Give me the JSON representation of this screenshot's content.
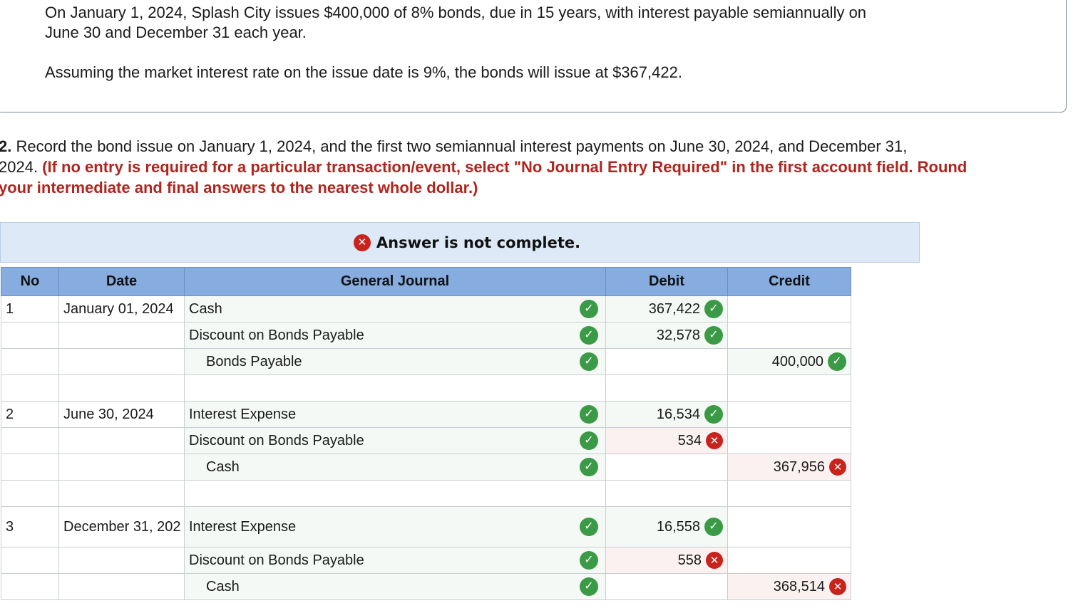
{
  "problem": {
    "line1": "On January 1, 2024, Splash City issues $400,000 of 8% bonds, due in 15 years, with interest payable semiannually on",
    "line2": "June 30 and December 31 each year.",
    "line3": "Assuming the market interest rate on the issue date is 9%, the bonds will issue at $367,422."
  },
  "question": {
    "number": "2.",
    "line1_text": " Record the bond issue on January 1, 2024, and the first two semiannual interest payments on June 30, 2024, and December 31,",
    "line2_text": "2024. ",
    "line2_instr": "(If no entry is required for a particular transaction/event, select \"No Journal Entry Required\" in the first account field. Round",
    "line3_instr": "your intermediate and final answers to the nearest whole dollar.)"
  },
  "banner": {
    "text": "Answer is not complete."
  },
  "table": {
    "headers": {
      "no": "No",
      "date": "Date",
      "journal": "General Journal",
      "debit": "Debit",
      "credit": "Credit"
    },
    "rows": [
      {
        "no": "1",
        "date": "January 01, 2024",
        "account": "Cash",
        "indent": false,
        "account_status": "correct",
        "debit": "367,422",
        "debit_status": "correct",
        "credit": "",
        "credit_status": ""
      },
      {
        "no": "",
        "date": "",
        "account": "Discount on Bonds Payable",
        "indent": false,
        "account_status": "correct",
        "debit": "32,578",
        "debit_status": "correct",
        "credit": "",
        "credit_status": ""
      },
      {
        "no": "",
        "date": "",
        "account": "Bonds Payable",
        "indent": true,
        "account_status": "correct",
        "debit": "",
        "debit_status": "",
        "credit": "400,000",
        "credit_status": "correct"
      },
      {
        "no": "",
        "date": "",
        "account": "",
        "indent": false,
        "account_status": "",
        "debit": "",
        "debit_status": "",
        "credit": "",
        "credit_status": ""
      },
      {
        "no": "2",
        "date": "June 30, 2024",
        "account": "Interest Expense",
        "indent": false,
        "account_status": "correct",
        "debit": "16,534",
        "debit_status": "correct",
        "credit": "",
        "credit_status": ""
      },
      {
        "no": "",
        "date": "",
        "account": "Discount on Bonds Payable",
        "indent": false,
        "account_status": "correct",
        "debit": "534",
        "debit_status": "wrong",
        "credit": "",
        "credit_status": ""
      },
      {
        "no": "",
        "date": "",
        "account": "Cash",
        "indent": true,
        "account_status": "correct",
        "debit": "",
        "debit_status": "",
        "credit": "367,956",
        "credit_status": "wrong"
      },
      {
        "no": "",
        "date": "",
        "account": "",
        "indent": false,
        "account_status": "",
        "debit": "",
        "debit_status": "",
        "credit": "",
        "credit_status": ""
      },
      {
        "no": "3",
        "date": "December 31, 202",
        "account": "Interest Expense",
        "indent": false,
        "account_status": "correct",
        "debit": "16,558",
        "debit_status": "correct",
        "credit": "",
        "credit_status": "",
        "tall": true
      },
      {
        "no": "",
        "date": "",
        "account": "Discount on Bonds Payable",
        "indent": false,
        "account_status": "correct",
        "debit": "558",
        "debit_status": "wrong",
        "credit": "",
        "credit_status": ""
      },
      {
        "no": "",
        "date": "",
        "account": "Cash",
        "indent": true,
        "account_status": "correct",
        "debit": "",
        "debit_status": "",
        "credit": "368,514",
        "credit_status": "wrong"
      }
    ]
  },
  "icons": {
    "correct": "check-circle-icon",
    "wrong": "x-circle-icon"
  },
  "colors": {
    "header_bg": "#87acdf",
    "banner_bg": "#dde9f6",
    "instruction_red": "#b0261e",
    "check_green": "#3a9a46",
    "wrong_red": "#c8231c"
  }
}
